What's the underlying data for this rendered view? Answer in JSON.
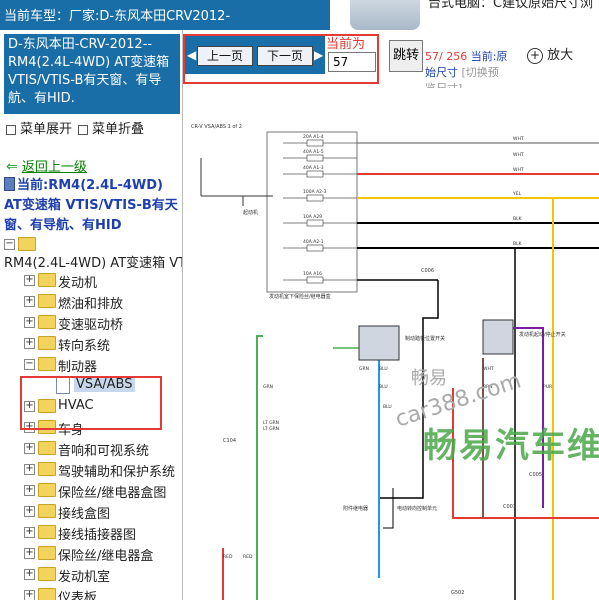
{
  "header": {
    "title": "当前车型：厂家:D-东风本田CRV2012-"
  },
  "ad": {
    "text": "台式电脑：C建议原始尺寸浏"
  },
  "sidebar": {
    "title": "D-东风本田-CRV-2012-- RM4(2.4L-4WD) AT变速箱VTIS/VTIS-B有天窗、有导航、有HID.",
    "expand_label": "菜单展开",
    "collapse_label": "菜单折叠",
    "back_label": "返回上一级",
    "current_label": "当前:RM4(2.4L-4WD) AT变速箱 VTIS/VTIS-B有天窗、有导航、有HID",
    "tree_root": "RM4(2.4L-4WD) AT变速箱 VTIS/VTIS-B",
    "tree_items": [
      "发动机",
      "燃油和排放",
      "变速驱动桥",
      "转向系统",
      "制动器",
      "VSA/ABS",
      "HVAC",
      "车身",
      "音响和可视系统",
      "驾驶辅助和保护系统",
      "保险丝/继电器盒图",
      "接线盒图",
      "接线插接器图",
      "保险丝/继电器盒",
      "发动机室",
      "仪表板"
    ]
  },
  "toolbar": {
    "prev_label": "上一页",
    "next_label": "下一页",
    "current_page_label": "当前为",
    "page_value": "57",
    "jump_label": "跳转",
    "page_count": "57/ 256",
    "current_link": "当前:原",
    "original_size_label": "始尺寸",
    "switch_label": "[切换预",
    "preview_size_label": "览尺寸]",
    "zoom_label": "放大"
  },
  "diagram": {
    "header_text": "CR-V VSA/ABS 1 of 2",
    "relay_label": "发动机室下保险丝/继电器盒",
    "fuses": [
      "20A A1-4",
      "40A A1-5",
      "40A A1-3",
      "100A A2-3",
      "10A A29",
      "40A A2-1",
      "10A A16"
    ],
    "wire_labels": [
      "WHT",
      "WHT",
      "WHT",
      "YEL",
      "BLK",
      "BLK",
      "BLU",
      "BLU",
      "GRN",
      "WHT",
      "BRN",
      "PUR",
      "LT GRN",
      "LT GRN",
      "RED",
      "RED",
      "GRN",
      "BLU"
    ],
    "connectors": [
      "C006",
      "C104",
      "C005",
      "C003",
      "G502"
    ],
    "switch_labels": [
      "制动踏板位置开关",
      "发动机起动/停止开关",
      "制动开关"
    ],
    "ground_labels": [
      "起动机",
      "附件继电器",
      "电动转向控制单元"
    ],
    "watermark_main": "畅易汽车维",
    "watermark_site": "car388.com",
    "watermark_char": "畅易"
  },
  "colors": {
    "accent": "#1a6ea8",
    "highlight": "#e53935",
    "link": "#1d3fb0",
    "back": "#008000"
  }
}
